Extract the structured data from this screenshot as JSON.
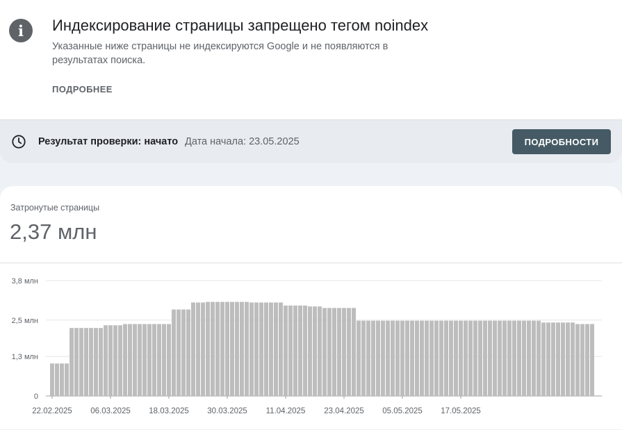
{
  "notice": {
    "icon": "info-icon",
    "title": "Индексирование страницы запрещено тегом noindex",
    "description": "Указанные ниже страницы не индексируются Google и не появляются в результатах поиска.",
    "more_link": "ПОДРОБНЕЕ"
  },
  "validation": {
    "icon": "clock-icon",
    "status": "Результат проверки: начато",
    "start_date": "Дата начала: 23.05.2025",
    "details_button": "ПОДРОБНОСТИ",
    "button_color": "#455a64"
  },
  "metric": {
    "label": "Затронутые страницы",
    "value": "2,37 млн"
  },
  "chart_data": {
    "type": "bar",
    "unit": "млн",
    "ylim": [
      0,
      3.8
    ],
    "y_ticks": [
      {
        "value": 0,
        "label": "0"
      },
      {
        "value": 1.3,
        "label": "1,3 млн"
      },
      {
        "value": 2.5,
        "label": "2,5 млн"
      },
      {
        "value": 3.8,
        "label": "3,8 млн"
      }
    ],
    "x_ticks": [
      "22.02.2025",
      "06.03.2025",
      "18.03.2025",
      "30.03.2025",
      "11.04.2025",
      "23.04.2025",
      "05.05.2025",
      "17.05.2025"
    ],
    "start_date": "22.02.2025",
    "values": [
      1.07,
      1.07,
      1.07,
      1.07,
      2.24,
      2.24,
      2.24,
      2.24,
      2.24,
      2.24,
      2.24,
      2.33,
      2.33,
      2.33,
      2.33,
      2.37,
      2.37,
      2.37,
      2.37,
      2.37,
      2.37,
      2.37,
      2.37,
      2.37,
      2.37,
      2.85,
      2.85,
      2.85,
      2.85,
      3.08,
      3.08,
      3.08,
      3.1,
      3.1,
      3.1,
      3.1,
      3.1,
      3.1,
      3.1,
      3.1,
      3.1,
      3.08,
      3.08,
      3.08,
      3.08,
      3.08,
      3.08,
      3.08,
      2.98,
      2.98,
      2.98,
      2.98,
      2.98,
      2.95,
      2.95,
      2.95,
      2.9,
      2.9,
      2.9,
      2.9,
      2.9,
      2.9,
      2.9,
      2.48,
      2.48,
      2.48,
      2.48,
      2.48,
      2.48,
      2.48,
      2.48,
      2.48,
      2.48,
      2.48,
      2.48,
      2.48,
      2.48,
      2.48,
      2.48,
      2.48,
      2.48,
      2.48,
      2.48,
      2.48,
      2.48,
      2.48,
      2.48,
      2.48,
      2.48,
      2.48,
      2.48,
      2.48,
      2.48,
      2.48,
      2.48,
      2.48,
      2.48,
      2.48,
      2.48,
      2.48,
      2.48,
      2.42,
      2.42,
      2.42,
      2.42,
      2.42,
      2.42,
      2.42,
      2.37,
      2.37,
      2.37,
      2.37
    ],
    "grid": true,
    "bar_color": "#bdbdbd"
  }
}
